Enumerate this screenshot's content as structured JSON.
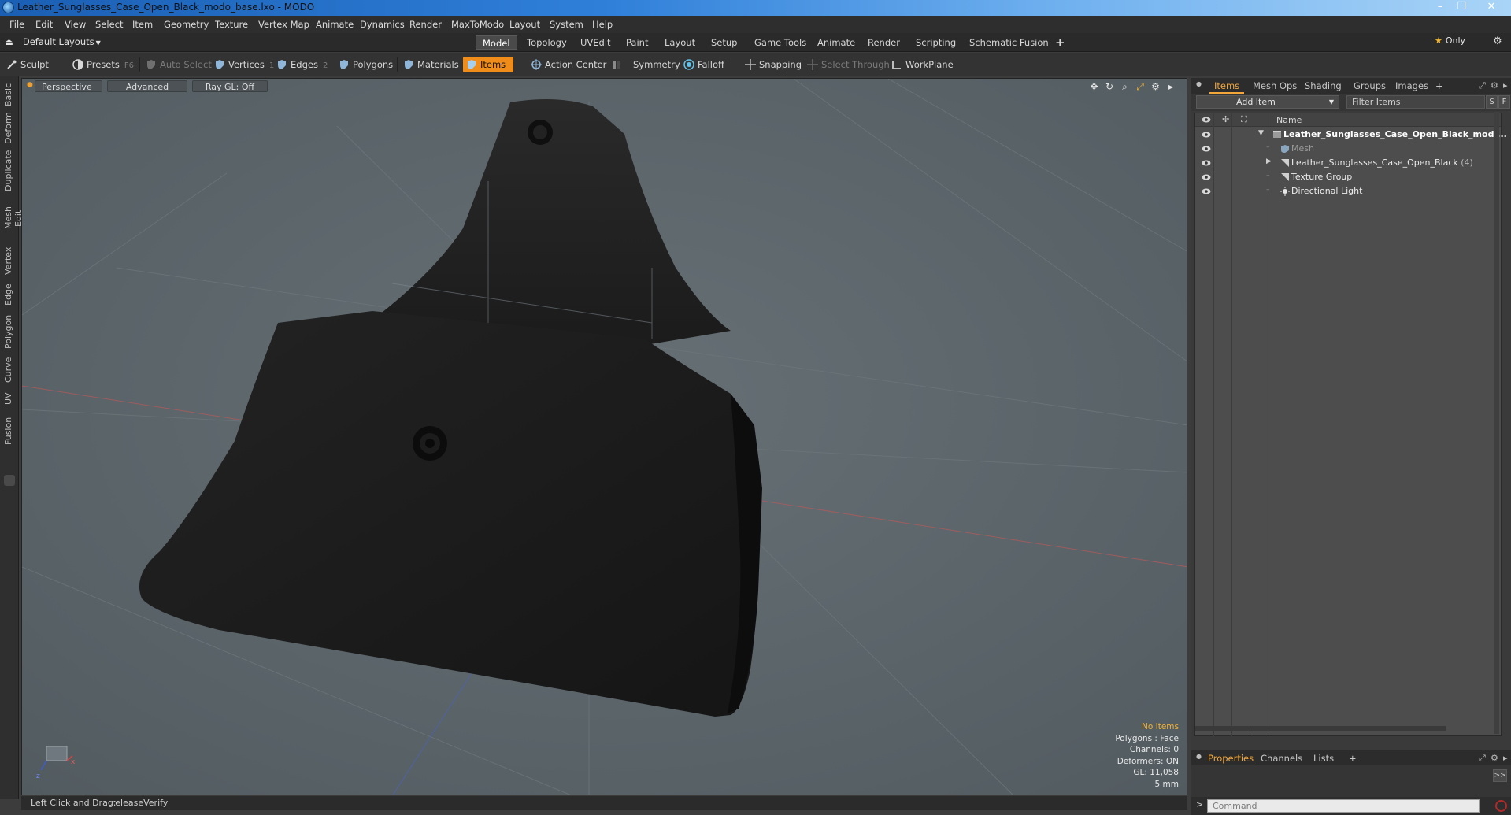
{
  "window": {
    "title": "Leather_Sunglasses_Case_Open_Black_modo_base.lxo - MODO",
    "minimize": "–",
    "restore": "❐",
    "close": "✕"
  },
  "menu": [
    "File",
    "Edit",
    "View",
    "Select",
    "Item",
    "Geometry",
    "Texture",
    "Vertex Map",
    "Animate",
    "Dynamics",
    "Render",
    "MaxToModo",
    "Layout",
    "System",
    "Help"
  ],
  "layout_selector": "Default Layouts",
  "layout_tabs": {
    "model": "Model",
    "topology": "Topology",
    "uvedit": "UVEdit",
    "paint": "Paint",
    "layout": "Layout",
    "setup": "Setup",
    "game_tools": "Game Tools",
    "animate": "Animate",
    "render": "Render",
    "scripting": "Scripting",
    "schematic_fusion": "Schematic Fusion",
    "add": "+",
    "only": "Only",
    "active": "model"
  },
  "toolbar": {
    "sculpt": "Sculpt",
    "presets": "Presets",
    "presets_key": "F6",
    "auto_select": "Auto Select",
    "vertices": "Vertices",
    "vertices_key": "1",
    "edges": "Edges",
    "edges_key": "2",
    "polygons": "Polygons",
    "materials": "Materials",
    "items": "Items",
    "action_center": "Action Center",
    "symmetry": "Symmetry",
    "falloff": "Falloff",
    "snapping": "Snapping",
    "select_through": "Select Through",
    "workplane": "WorkPlane"
  },
  "left_tabs": [
    "Basic",
    "Deform",
    "Duplicate",
    "Mesh Edit",
    "Vertex",
    "Edge",
    "Polygon",
    "Curve",
    "UV",
    "Fusion"
  ],
  "viewport": {
    "view_mode": "Perspective",
    "shading": "Advanced",
    "raygl": "Ray GL: Off",
    "info": {
      "selection": "No Items",
      "polygons": "Polygons : Face",
      "channels": "Channels: 0",
      "deformers": "Deformers: ON",
      "gl": "GL: 11,058",
      "units": "5 mm"
    }
  },
  "status": {
    "hint_label": "Left Click and Drag:",
    "hint_value": "releaseVerify"
  },
  "items_panel": {
    "tabs": [
      "Items",
      "Mesh Ops",
      "Shading",
      "Groups",
      "Images",
      "+"
    ],
    "add_item": "Add Item",
    "filter_placeholder": "Filter Items",
    "s_btn": "S",
    "f_btn": "F",
    "column_name": "Name",
    "rows": [
      {
        "label": "Leather_Sunglasses_Case_Open_Black_mod ...",
        "style": "bold",
        "indent": 0
      },
      {
        "label": "Mesh",
        "style": "dim",
        "indent": 1
      },
      {
        "label": "Leather_Sunglasses_Case_Open_Black",
        "count": "(4)",
        "style": "normal",
        "indent": 1
      },
      {
        "label": "Texture Group",
        "style": "normal",
        "indent": 1
      },
      {
        "label": "Directional Light",
        "style": "normal",
        "indent": 1
      }
    ]
  },
  "properties_panel": {
    "tabs": [
      "Properties",
      "Channels",
      "Lists",
      "+"
    ],
    "expand": ">>",
    "command_placeholder": "Command"
  },
  "colors": {
    "accent": "#f08c1a",
    "viewport_bg": "#5b6469",
    "model": "#1f1f1f"
  }
}
